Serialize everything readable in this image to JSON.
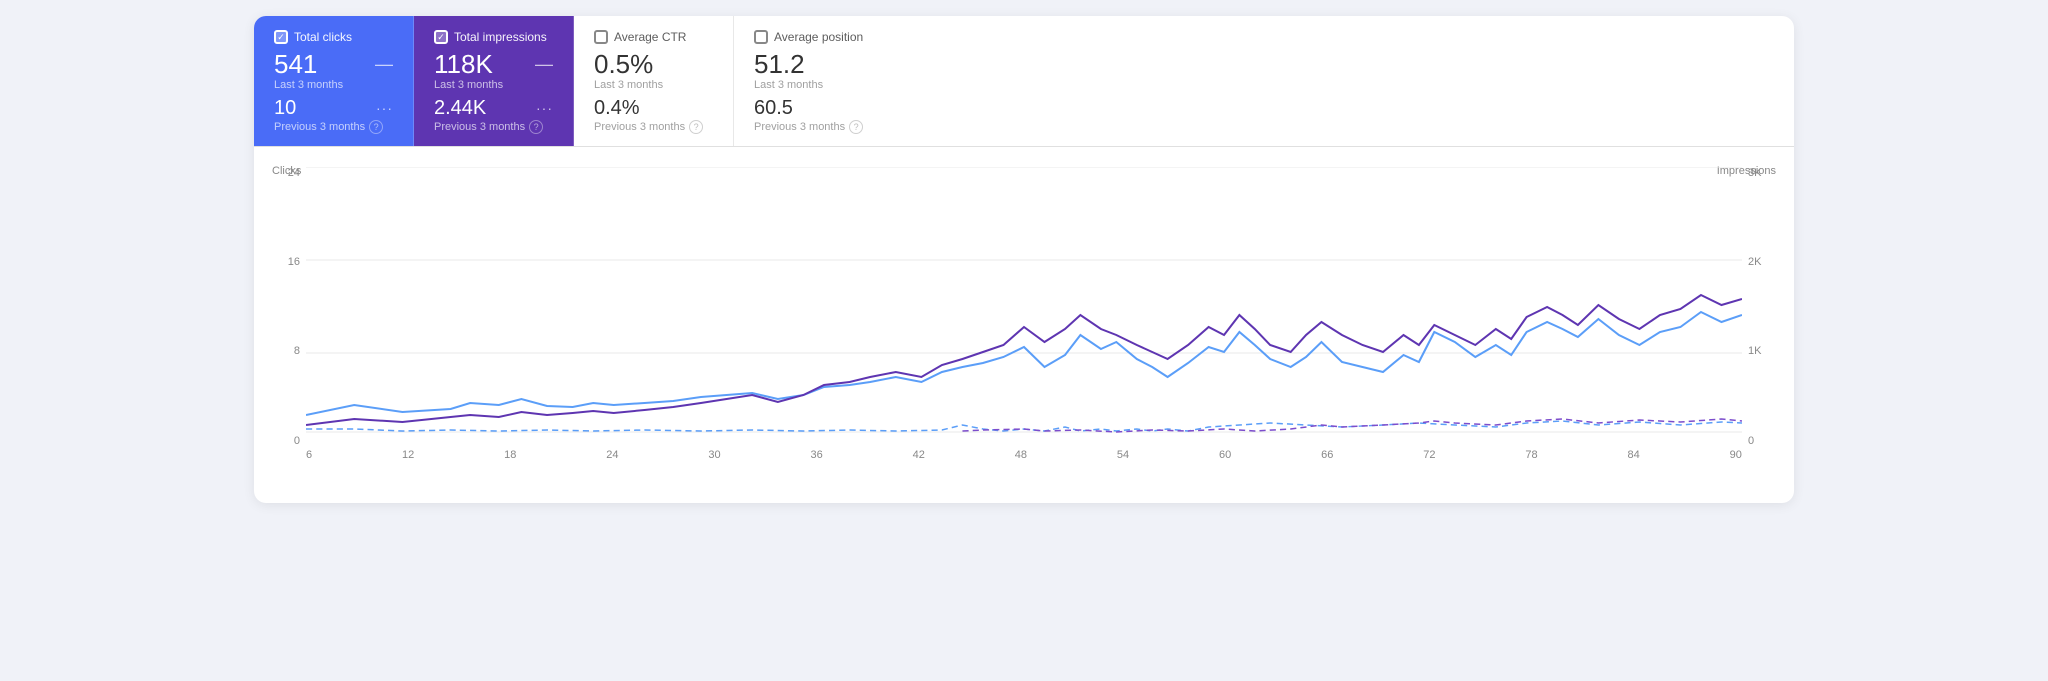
{
  "metrics": [
    {
      "id": "total-clicks",
      "title": "Total clicks",
      "checked": true,
      "value": "541",
      "sub_label": "Last 3 months",
      "prev_value": "10",
      "prev_label": "Previous 3 months",
      "dash": "—",
      "prev_dots": "···",
      "theme": "blue"
    },
    {
      "id": "total-impressions",
      "title": "Total impressions",
      "checked": true,
      "value": "118K",
      "sub_label": "Last 3 months",
      "prev_value": "2.44K",
      "prev_label": "Previous 3 months",
      "dash": "—",
      "prev_dots": "···",
      "theme": "purple"
    },
    {
      "id": "average-ctr",
      "title": "Average CTR",
      "checked": false,
      "value": "0.5%",
      "sub_label": "Last 3 months",
      "prev_value": "0.4%",
      "prev_label": "Previous 3 months",
      "dash": "",
      "prev_dots": "",
      "theme": "light"
    },
    {
      "id": "average-position",
      "title": "Average position",
      "checked": false,
      "value": "51.2",
      "sub_label": "Last 3 months",
      "prev_value": "60.5",
      "prev_label": "Previous 3 months",
      "dash": "",
      "prev_dots": "",
      "theme": "light"
    }
  ],
  "chart": {
    "y_labels_left": [
      "24",
      "16",
      "8",
      "0"
    ],
    "y_labels_right": [
      "3K",
      "2K",
      "1K",
      "0"
    ],
    "axis_left": "Clicks",
    "axis_right": "Impressions",
    "x_labels": [
      "6",
      "12",
      "18",
      "24",
      "30",
      "36",
      "42",
      "48",
      "54",
      "60",
      "66",
      "72",
      "78",
      "84",
      "90"
    ]
  }
}
